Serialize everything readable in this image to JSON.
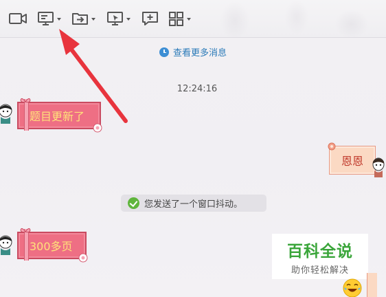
{
  "toolbar": {
    "buttons": [
      {
        "name": "video-call",
        "icon": "video-camera-icon",
        "has_dropdown": false
      },
      {
        "name": "screen-share",
        "icon": "monitor-icon",
        "has_dropdown": true
      },
      {
        "name": "send-file",
        "icon": "folder-icon",
        "has_dropdown": true
      },
      {
        "name": "remote-assist",
        "icon": "remote-desktop-icon",
        "has_dropdown": true
      },
      {
        "name": "add-app",
        "icon": "add-chat-icon",
        "has_dropdown": false
      },
      {
        "name": "more-apps",
        "icon": "app-grid-icon",
        "has_dropdown": true
      }
    ]
  },
  "history_link": "查看更多消息",
  "timestamp": "12:24:16",
  "messages": [
    {
      "side": "left",
      "text": "题目更新了",
      "style": "gift-red"
    },
    {
      "side": "right",
      "text": "恩恩",
      "style": "peach"
    },
    {
      "side": "system",
      "text": "您发送了一个窗口抖动。"
    },
    {
      "side": "left",
      "text": "300多页",
      "style": "gift-red"
    }
  ],
  "watermark": {
    "title": "百科全说",
    "subtitle": "助你轻松解决"
  },
  "colors": {
    "link": "#2a7ab8",
    "gift_bubble": "#ee6f84",
    "gift_text": "#ffe27a",
    "peach_bubble": "#fbd9c3",
    "peach_text": "#c0392b",
    "arrow": "#e8343d",
    "watermark_green": "#3aa53a"
  }
}
